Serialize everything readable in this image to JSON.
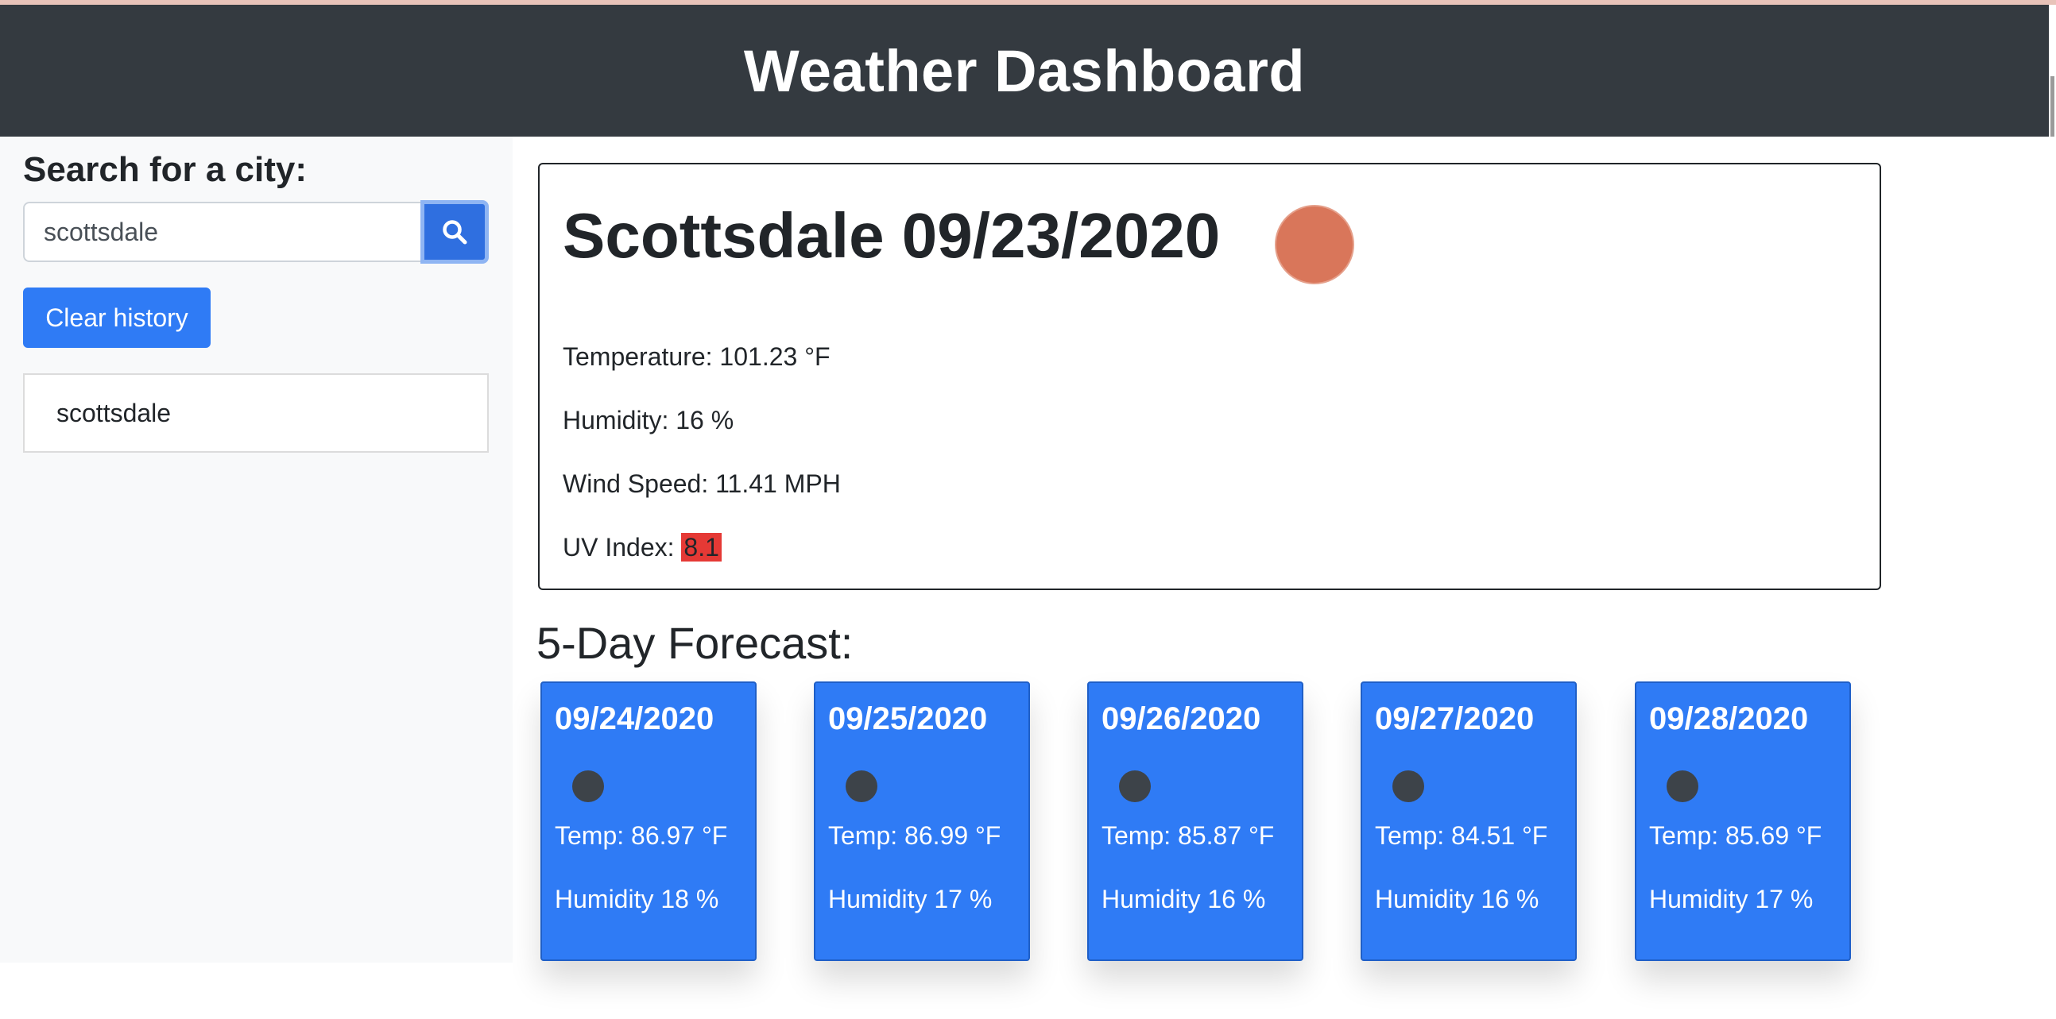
{
  "header": {
    "title": "Weather Dashboard"
  },
  "sidebar": {
    "search_label": "Search for a city:",
    "search_value": "scottsdale",
    "search_button_icon": "search-icon",
    "clear_button_label": "Clear history",
    "history": [
      "scottsdale"
    ]
  },
  "current": {
    "title": "Scottsdale 09/23/2020",
    "icon": "sun-icon",
    "temperature": "Temperature: 101.23 °F",
    "humidity": "Humidity: 16 %",
    "wind": "Wind Speed: 11.41 MPH",
    "uv_label": "UV Index: ",
    "uv_value": "8.1",
    "uv_color": "#e53935"
  },
  "forecast": {
    "title": "5-Day Forecast:",
    "card_color": "#2f7bf5",
    "days": [
      {
        "date": "09/24/2020",
        "icon": "weather-icon",
        "temp": "Temp: 86.97 °F",
        "humidity": "Humidity 18 %"
      },
      {
        "date": "09/25/2020",
        "icon": "weather-icon",
        "temp": "Temp: 86.99 °F",
        "humidity": "Humidity 17 %"
      },
      {
        "date": "09/26/2020",
        "icon": "weather-icon",
        "temp": "Temp: 85.87 °F",
        "humidity": "Humidity 16 %"
      },
      {
        "date": "09/27/2020",
        "icon": "weather-icon",
        "temp": "Temp: 84.51 °F",
        "humidity": "Humidity 16 %"
      },
      {
        "date": "09/28/2020",
        "icon": "weather-icon",
        "temp": "Temp: 85.69 °F",
        "humidity": "Humidity 17 %"
      }
    ]
  }
}
